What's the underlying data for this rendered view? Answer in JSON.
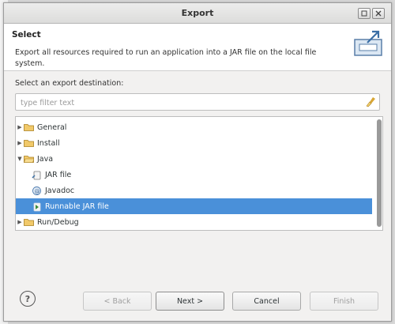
{
  "dialog": {
    "title": "Export",
    "page_title": "Select",
    "description": "Export all resources required to run an application into a JAR file on the local file system.",
    "destination_label": "Select an export destination:",
    "filter_placeholder": "type filter text",
    "filter_value": ""
  },
  "tree": {
    "items": [
      {
        "label": "General",
        "kind": "folder",
        "expanded": false,
        "depth": 0
      },
      {
        "label": "Install",
        "kind": "folder",
        "expanded": false,
        "depth": 0
      },
      {
        "label": "Java",
        "kind": "folder",
        "expanded": true,
        "depth": 0
      },
      {
        "label": "JAR file",
        "kind": "jar-icon",
        "depth": 1
      },
      {
        "label": "Javadoc",
        "kind": "javadoc-icon",
        "depth": 1
      },
      {
        "label": "Runnable JAR file",
        "kind": "runnable-jar-icon",
        "depth": 1,
        "selected": true
      },
      {
        "label": "Run/Debug",
        "kind": "folder",
        "expanded": false,
        "depth": 0
      }
    ]
  },
  "buttons": {
    "help": "?",
    "back": "< Back",
    "next": "Next >",
    "cancel": "Cancel",
    "finish": "Finish"
  },
  "colors": {
    "selection": "#4a90d9",
    "folder": "#e8b84a"
  }
}
